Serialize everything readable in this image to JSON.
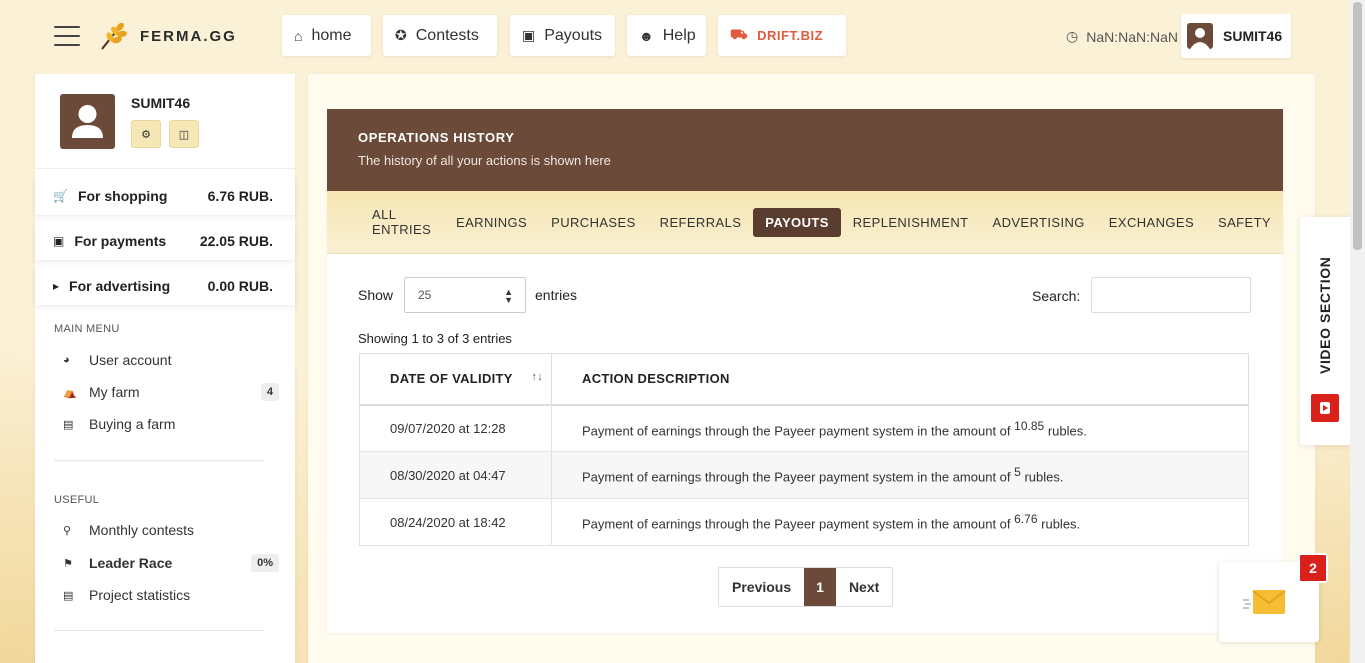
{
  "header": {
    "logo_text": "FERMA.GG",
    "nav": [
      {
        "label": "home",
        "icon": "home-icon"
      },
      {
        "label": "Contests",
        "icon": "contests-icon"
      },
      {
        "label": "Payouts",
        "icon": "wallet-icon"
      },
      {
        "label": "Help",
        "icon": "support-icon"
      },
      {
        "label": "DRIFT.BIZ",
        "icon": "cars-icon"
      }
    ],
    "clock": "NaN:NaN:NaN",
    "username": "SUMIT46"
  },
  "sidebar": {
    "username": "SUMIT46",
    "balances": [
      {
        "label": "For shopping",
        "amount": "6.76 RUB."
      },
      {
        "label": "For payments",
        "amount": "22.05 RUB."
      },
      {
        "label": "For advertising",
        "amount": "0.00 RUB."
      }
    ],
    "main_menu_title": "MAIN MENU",
    "main_menu": [
      {
        "label": "User account"
      },
      {
        "label": "My farm",
        "badge": "4"
      },
      {
        "label": "Buying a farm"
      }
    ],
    "useful_title": "USEFUL",
    "useful": [
      {
        "label": "Monthly contests"
      },
      {
        "label": "Leader Race",
        "badge": "0%"
      },
      {
        "label": "Project statistics"
      }
    ]
  },
  "card": {
    "title": "OPERATIONS HISTORY",
    "subtitle": "The history of all your actions is shown here",
    "tabs": [
      "ALL ENTRIES",
      "EARNINGS",
      "PURCHASES",
      "REFERRALS",
      "PAYOUTS",
      "REPLENISHMENT",
      "ADVERTISING",
      "EXCHANGES",
      "SAFETY"
    ],
    "active_tab": "PAYOUTS",
    "show_label": "Show",
    "entries_value": "25",
    "entries_label": "entries",
    "search_label": "Search:",
    "info": "Showing 1 to 3 of 3 entries",
    "columns": [
      "DATE OF VALIDITY",
      "ACTION DESCRIPTION"
    ],
    "rows": [
      {
        "date": "09/07/2020 at 12:28",
        "desc_pre": "Payment of earnings through the Payeer payment system in the amount of",
        "amount": "10.85",
        "desc_post": "rubles."
      },
      {
        "date": "08/30/2020 at 04:47",
        "desc_pre": "Payment of earnings through the Payeer payment system in the amount of",
        "amount": "5",
        "desc_post": "rubles."
      },
      {
        "date": "08/24/2020 at 18:42",
        "desc_pre": "Payment of earnings through the Payeer payment system in the amount of",
        "amount": "6.76",
        "desc_post": "rubles."
      }
    ],
    "pager": {
      "previous": "Previous",
      "current": "1",
      "next": "Next"
    }
  },
  "video_section": "VIDEO SECTION",
  "mail_count": "2",
  "colors": {
    "brown": "#6b4a3a",
    "active_tab": "#5b3d30",
    "drift_red": "#e05a3c",
    "badge_red": "#d9201a"
  }
}
